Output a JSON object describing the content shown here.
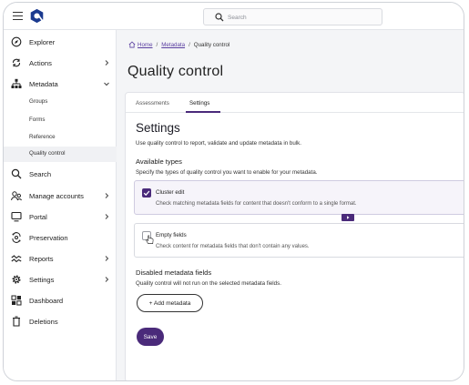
{
  "topbar": {
    "search_placeholder": "Search"
  },
  "sidebar": {
    "items": [
      {
        "label": "Explorer",
        "icon": "compass-icon"
      },
      {
        "label": "Actions",
        "icon": "refresh-icon"
      },
      {
        "label": "Metadata",
        "icon": "hierarchy-icon"
      },
      {
        "label": "Search",
        "icon": "search-icon"
      },
      {
        "label": "Manage accounts",
        "icon": "users-icon"
      },
      {
        "label": "Portal",
        "icon": "monitor-icon"
      },
      {
        "label": "Preservation",
        "icon": "preservation-icon"
      },
      {
        "label": "Reports",
        "icon": "chart-line-icon"
      },
      {
        "label": "Settings",
        "icon": "gear-icon"
      },
      {
        "label": "Dashboard",
        "icon": "dashboard-icon"
      },
      {
        "label": "Deletions",
        "icon": "trash-icon"
      }
    ],
    "metadata_sub": [
      "Groups",
      "Forms",
      "Reference",
      "Quality control"
    ]
  },
  "breadcrumb": {
    "home": "Home",
    "metadata": "Metadata",
    "current": "Quality control",
    "separator": "/"
  },
  "page": {
    "title": "Quality control"
  },
  "tabs": [
    "Assessments",
    "Settings"
  ],
  "settings": {
    "heading": "Settings",
    "description": "Use quality control to report, validate and update metadata in bulk.",
    "available_heading": "Available types",
    "available_description": "Specify the types of quality control you want to enable for your metadata.",
    "options": [
      {
        "title": "Cluster edit",
        "description": "Check matching metadata fields for content that doesn't conform to a single format.",
        "checked": true
      },
      {
        "title": "Empty fields",
        "description": "Check content for metadata fields that don't contain any values.",
        "checked": false
      }
    ],
    "disabled_heading": "Disabled metadata fields",
    "disabled_description": "Quality control will not run on the selected metadata fields.",
    "add_button": "+ Add metadata",
    "save_button": "Save"
  },
  "colors": {
    "accent": "#4a2a7a",
    "link": "#5a3fa0",
    "logo": "#1b3a8f"
  }
}
